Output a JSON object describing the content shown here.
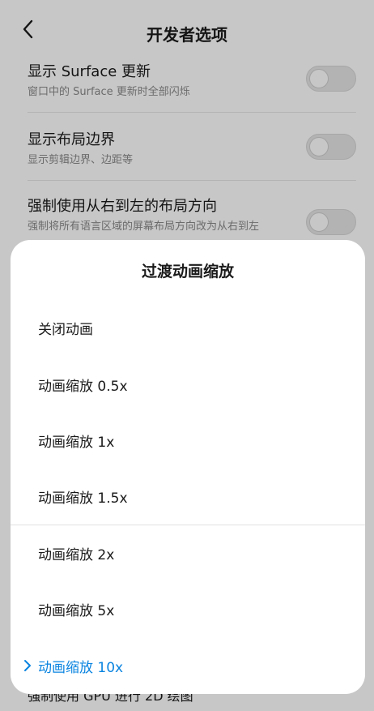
{
  "header": {
    "title": "开发者选项"
  },
  "settings": [
    {
      "title": "显示 Surface 更新",
      "subtitle": "窗口中的 Surface 更新时全部闪烁"
    },
    {
      "title": "显示布局边界",
      "subtitle": "显示剪辑边界、边距等"
    },
    {
      "title": "强制使用从右到左的布局方向",
      "subtitle": "强制将所有语言区域的屏幕布局方向改为从右到左"
    }
  ],
  "behind": {
    "partial_text": "强制使用 GPU 进行 2D 绘图"
  },
  "sheet": {
    "title": "过渡动画缩放",
    "options": [
      "关闭动画",
      "动画缩放 0.5x",
      "动画缩放 1x",
      "动画缩放 1.5x",
      "动画缩放 2x",
      "动画缩放 5x",
      "动画缩放 10x"
    ],
    "selected": "动画缩放 10x"
  },
  "colors": {
    "accent": "#0a84e0",
    "scrim": "rgba(0,0,0,0.22)"
  },
  "icons": {
    "back": "chevron-left-icon",
    "selected_marker": "chevron-right-icon"
  }
}
